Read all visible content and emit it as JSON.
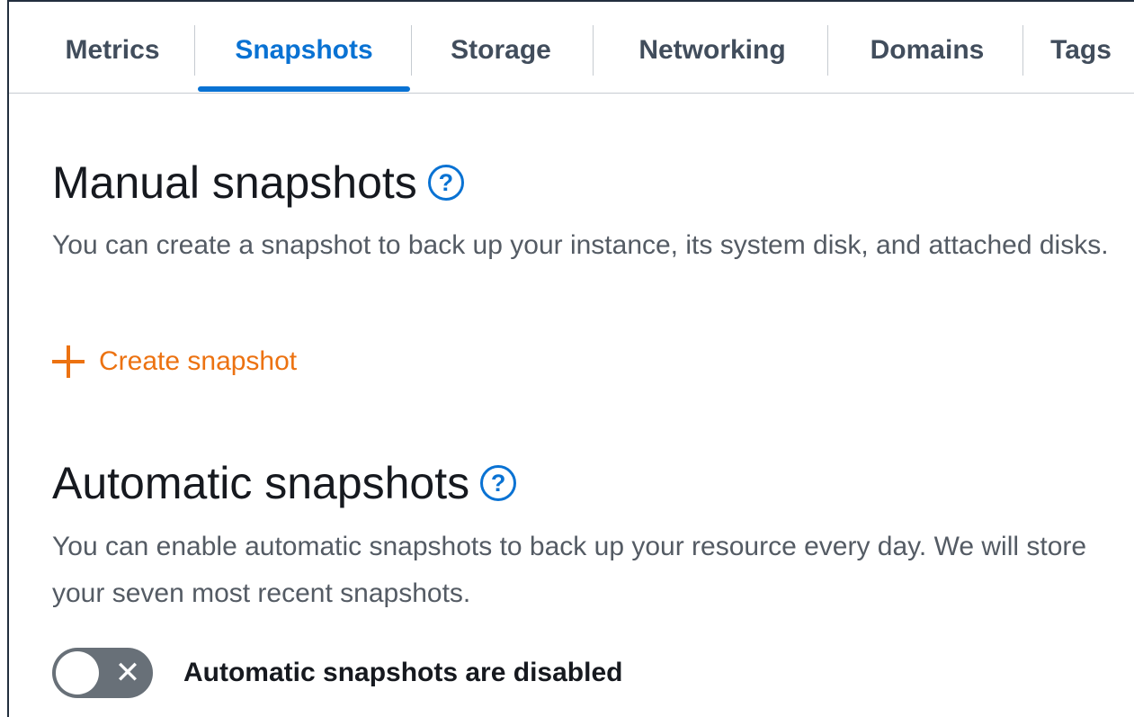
{
  "tabs": [
    {
      "label": "Metrics",
      "active": false
    },
    {
      "label": "Snapshots",
      "active": true
    },
    {
      "label": "Storage",
      "active": false
    },
    {
      "label": "Networking",
      "active": false
    },
    {
      "label": "Domains",
      "active": false
    },
    {
      "label": "Tags",
      "active": false
    }
  ],
  "manual": {
    "title": "Manual snapshots",
    "help_glyph": "?",
    "description": "You can create a snapshot to back up your instance, its system disk, and attached disks.",
    "create_label": "Create snapshot"
  },
  "automatic": {
    "title": "Automatic snapshots",
    "help_glyph": "?",
    "description": "You can enable automatic snapshots to back up your resource every day. We will store your seven most recent snapshots.",
    "toggle_label": "Automatic snapshots are disabled",
    "toggle_state": "off",
    "toggle_glyph": "✕"
  },
  "colors": {
    "accent": "#0972d3",
    "action": "#ec7211",
    "text": "#16191f",
    "muted": "#545b64",
    "toggle_off": "#687078"
  },
  "icons": [
    "help-icon",
    "plus-icon",
    "toggle-off-icon"
  ]
}
